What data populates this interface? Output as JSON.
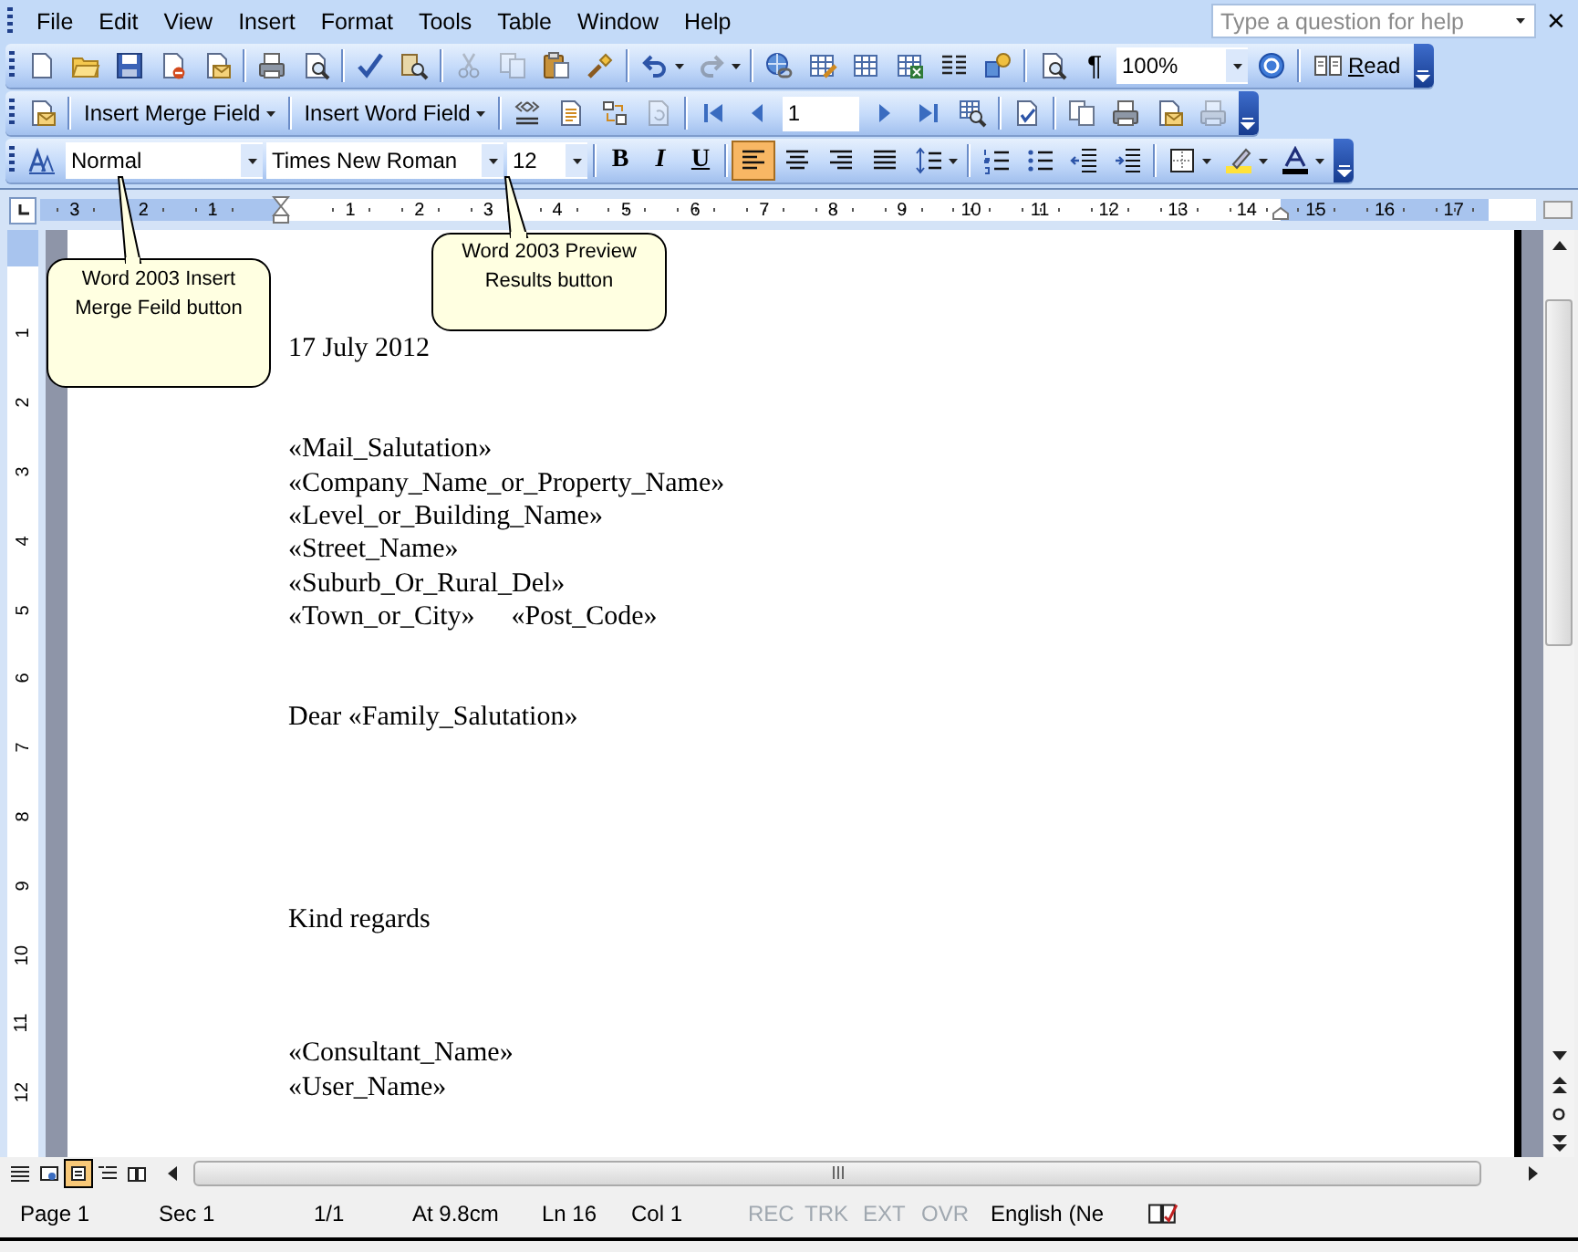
{
  "menu": [
    "File",
    "Edit",
    "View",
    "Insert",
    "Format",
    "Tools",
    "Table",
    "Window",
    "Help"
  ],
  "help_box": {
    "placeholder": "Type a question for help"
  },
  "close": "×",
  "toolbars": [
    {
      "items": [
        {
          "kind": "icon",
          "disabled": false
        },
        {
          "kind": "icon",
          "disabled": false
        },
        {
          "kind": "icon",
          "disabled": false
        },
        {
          "kind": "icon",
          "disabled": false
        },
        {
          "kind": "icon",
          "disabled": false
        },
        {
          "kind": "sep"
        },
        {
          "kind": "icon",
          "disabled": false
        },
        {
          "kind": "icon",
          "disabled": false
        },
        {
          "kind": "sep"
        },
        {
          "kind": "icon",
          "disabled": false
        },
        {
          "kind": "icon",
          "disabled": false
        },
        {
          "kind": "sep"
        },
        {
          "kind": "icon",
          "disabled": true
        },
        {
          "kind": "icon",
          "disabled": true
        },
        {
          "kind": "icon",
          "disabled": false
        },
        {
          "kind": "icon",
          "disabled": false
        },
        {
          "kind": "sep"
        },
        {
          "kind": "dropdown-icon",
          "disabled": false
        },
        {
          "kind": "dropdown-icon",
          "disabled": true
        },
        {
          "kind": "sep"
        },
        {
          "kind": "icon",
          "disabled": false
        },
        {
          "kind": "icon",
          "disabled": false
        },
        {
          "kind": "icon",
          "disabled": false
        },
        {
          "kind": "icon",
          "disabled": false
        },
        {
          "kind": "icon",
          "disabled": false
        },
        {
          "kind": "icon",
          "disabled": false
        },
        {
          "kind": "sep"
        },
        {
          "kind": "icon",
          "disabled": false
        },
        {
          "kind": "glyph",
          "text": "¶",
          "selected": false
        },
        {
          "kind": "combo",
          "value": "100%"
        },
        {
          "kind": "icon",
          "disabled": false
        },
        {
          "kind": "sep"
        },
        {
          "kind": "text-button",
          "text": "Read"
        }
      ]
    },
    {
      "items": [
        {
          "kind": "icon",
          "disabled": false
        },
        {
          "kind": "sep"
        },
        {
          "kind": "text-dropdown",
          "text": "Insert Merge Field"
        },
        {
          "kind": "sep"
        },
        {
          "kind": "text-dropdown",
          "text": "Insert Word Field"
        },
        {
          "kind": "sep"
        },
        {
          "kind": "icon",
          "disabled": false
        },
        {
          "kind": "icon",
          "disabled": false
        },
        {
          "kind": "icon",
          "disabled": false
        },
        {
          "kind": "icon",
          "disabled": true
        },
        {
          "kind": "sep"
        },
        {
          "kind": "icon",
          "disabled": false
        },
        {
          "kind": "icon",
          "disabled": false
        },
        {
          "kind": "field",
          "value": "1"
        },
        {
          "kind": "icon",
          "disabled": false
        },
        {
          "kind": "icon",
          "disabled": false
        },
        {
          "kind": "icon",
          "disabled": false
        },
        {
          "kind": "sep"
        },
        {
          "kind": "icon",
          "disabled": false
        },
        {
          "kind": "sep"
        },
        {
          "kind": "icon",
          "disabled": false
        },
        {
          "kind": "icon",
          "disabled": false
        },
        {
          "kind": "icon",
          "disabled": false
        },
        {
          "kind": "icon",
          "disabled": true
        }
      ]
    },
    {
      "items": [
        {
          "kind": "icon",
          "disabled": false
        },
        {
          "kind": "combo",
          "value": "Normal"
        },
        {
          "kind": "combo",
          "value": "Times New Roman"
        },
        {
          "kind": "combo",
          "value": "12"
        },
        {
          "kind": "sep"
        },
        {
          "kind": "glyph",
          "text": "B",
          "selected": false
        },
        {
          "kind": "glyph",
          "text": "I",
          "selected": false
        },
        {
          "kind": "glyph",
          "text": "U",
          "selected": false
        },
        {
          "kind": "sep"
        },
        {
          "kind": "icon",
          "disabled": false,
          "selected": true
        },
        {
          "kind": "icon",
          "disabled": false,
          "selected": false
        },
        {
          "kind": "icon",
          "disabled": false,
          "selected": false
        },
        {
          "kind": "icon",
          "disabled": false,
          "selected": false
        },
        {
          "kind": "dropdown-icon",
          "disabled": false
        },
        {
          "kind": "sep"
        },
        {
          "kind": "icon",
          "disabled": false
        },
        {
          "kind": "icon",
          "disabled": false
        },
        {
          "kind": "icon",
          "disabled": false
        },
        {
          "kind": "icon",
          "disabled": false
        },
        {
          "kind": "sep"
        },
        {
          "kind": "dropdown-icon",
          "disabled": false
        },
        {
          "kind": "dropdown-icon",
          "disabled": false
        },
        {
          "kind": "dropdown-icon",
          "disabled": false
        }
      ]
    }
  ],
  "ruler": {
    "left_labels": [
      "3",
      "2",
      "1"
    ],
    "labels": [
      "1",
      "2",
      "3",
      "4",
      "5",
      "6",
      "7",
      "8",
      "9",
      "10",
      "11",
      "12",
      "13",
      "14"
    ],
    "right_labels": [
      "15",
      "16",
      "17"
    ]
  },
  "vertical_ruler": {
    "labels": [
      "1",
      "2",
      "3",
      "4",
      "5",
      "6",
      "7",
      "8",
      "9",
      "10",
      "11",
      "12"
    ]
  },
  "callouts": [
    {
      "text": "Word 2003 Insert Merge Feild button"
    },
    {
      "text": "Word 2003 Preview Results button"
    }
  ],
  "letter": {
    "blocks": [
      {
        "kind": "date",
        "lines": [
          "17 July 2012"
        ]
      },
      {
        "kind": "address",
        "lines": [
          "«Mail_Salutation»",
          "«Company_Name_or_Property_Name»",
          "«Level_or_Building_Name»",
          "«Street_Name»",
          "«Suburb_Or_Rural_Del»",
          [
            "«Town_or_City»",
            "«Post_Code»"
          ]
        ]
      },
      {
        "kind": "greeting",
        "lines": [
          "Dear «Family_Salutation»"
        ]
      },
      {
        "kind": "closing",
        "lines": [
          "Kind regards"
        ]
      },
      {
        "kind": "signature",
        "lines": [
          "«Consultant_Name»",
          "«User_Name»"
        ]
      }
    ]
  },
  "view_buttons": [
    {
      "selected": false
    },
    {
      "selected": false
    },
    {
      "selected": true
    },
    {
      "selected": false
    },
    {
      "selected": false
    }
  ],
  "status_bar": {
    "items": [
      {
        "text": "Page 1",
        "disabled": false
      },
      {
        "text": "Sec 1",
        "disabled": false
      },
      {
        "text": "1/1",
        "disabled": false
      },
      {
        "text": "At 9.8cm",
        "disabled": false
      },
      {
        "text": "Ln 16",
        "disabled": false
      },
      {
        "text": "Col 1",
        "disabled": false
      },
      {
        "text": "REC",
        "disabled": true
      },
      {
        "text": "TRK",
        "disabled": true
      },
      {
        "text": "EXT",
        "disabled": true
      },
      {
        "text": "OVR",
        "disabled": true
      },
      {
        "text": "English (Ne",
        "disabled": false
      }
    ]
  }
}
